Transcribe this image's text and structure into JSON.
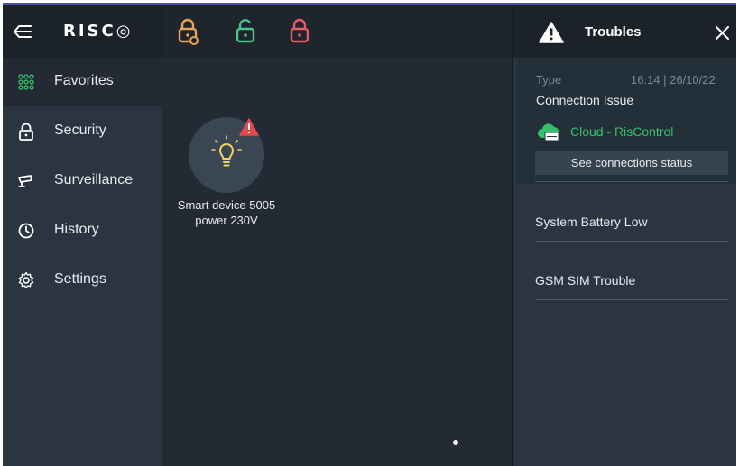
{
  "app": {
    "logo": "RISC◎"
  },
  "colors": {
    "accent_bar": "#4a4fa0",
    "lock_orange": "#e8a35a",
    "lock_green": "#4cc28e",
    "lock_red": "#e65c63",
    "alert_red": "#e5484d",
    "cloud_green": "#35c06a",
    "bulb_yellow": "#f2d35e"
  },
  "topbar": {
    "icons": [
      "menu-back-icon",
      "partial-arm-lock-icon",
      "disarm-unlock-icon",
      "full-arm-lock-icon"
    ]
  },
  "sidebar": {
    "items": [
      {
        "label": "Favorites",
        "icon": "grid-icon",
        "active": true
      },
      {
        "label": "Security",
        "icon": "lock-icon",
        "active": false
      },
      {
        "label": "Surveillance",
        "icon": "camera-icon",
        "active": false
      },
      {
        "label": "History",
        "icon": "history-icon",
        "active": false
      },
      {
        "label": "Settings",
        "icon": "gear-icon",
        "active": false
      }
    ]
  },
  "main": {
    "device": {
      "name_line1": "Smart device 5005",
      "name_line2": "power 230V",
      "icon": "lightbulb-icon",
      "alert": true
    }
  },
  "troubles": {
    "title": "Troubles",
    "type_label": "Type",
    "timestamp": "16:14 | 26/10/22",
    "issue": "Connection Issue",
    "cloud_label": "Cloud - RisControl",
    "connections_button": "See connections status",
    "items": [
      "System Battery Low",
      "GSM SIM Trouble"
    ]
  }
}
